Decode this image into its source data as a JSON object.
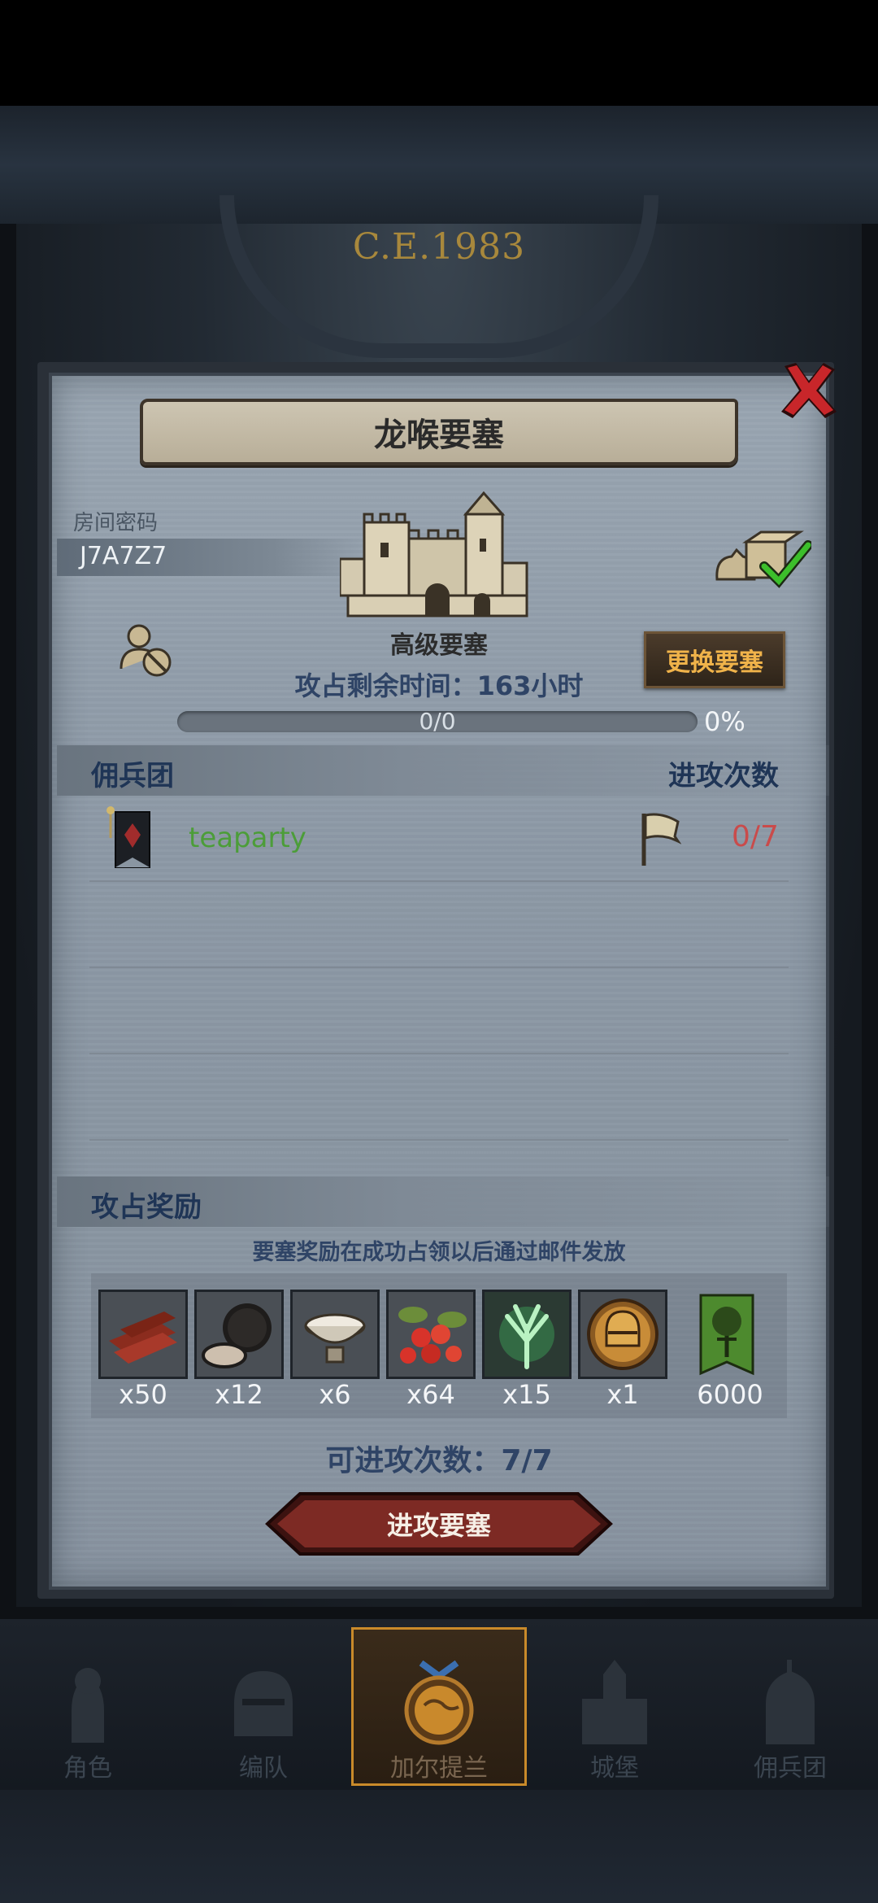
{
  "world": {
    "era": "C.E.1983"
  },
  "dialog": {
    "title": "龙喉要塞",
    "room_code_label": "房间密码",
    "room_code": "J7A7Z7",
    "fortress_level": "高级要塞",
    "switch_button": "更换要塞",
    "remaining_time": "攻占剩余时间：163小时",
    "progress_text": "0/0",
    "progress_percent": "0%",
    "progress_fraction": 0,
    "mercenary_header": "佣兵团",
    "attacks_header": "进攻次数",
    "team": {
      "name": "teaparty",
      "attacks": "0/7"
    },
    "reward_header": "攻占奖励",
    "reward_note": "要塞奖励在成功占领以后通过邮件发放",
    "rewards": [
      {
        "icon": "wood-planks-icon",
        "qty": "x50"
      },
      {
        "icon": "truffle-icon",
        "qty": "x12"
      },
      {
        "icon": "milk-bowl-icon",
        "qty": "x6"
      },
      {
        "icon": "berries-icon",
        "qty": "x64"
      },
      {
        "icon": "green-herb-icon",
        "qty": "x15"
      },
      {
        "icon": "knight-helmet-coin-icon",
        "qty": "x1"
      },
      {
        "icon": "green-tree-banner-icon",
        "qty": "6000"
      }
    ],
    "available_attacks": "可进攻次数：7/7",
    "attack_button": "进攻要塞"
  },
  "nav": {
    "items": [
      {
        "label": "角色",
        "icon": "knight-icon"
      },
      {
        "label": "编队",
        "icon": "helmet-icon"
      },
      {
        "label": "加尔提兰",
        "icon": "map-globe-icon",
        "active": true
      },
      {
        "label": "城堡",
        "icon": "castle-icon"
      },
      {
        "label": "佣兵团",
        "icon": "banner-knight-icon"
      }
    ]
  },
  "colors": {
    "accent_orange": "#f0b34a",
    "team_green": "#4c9d39",
    "count_red": "#c94b4b",
    "heading_blue": "#1f3556"
  }
}
